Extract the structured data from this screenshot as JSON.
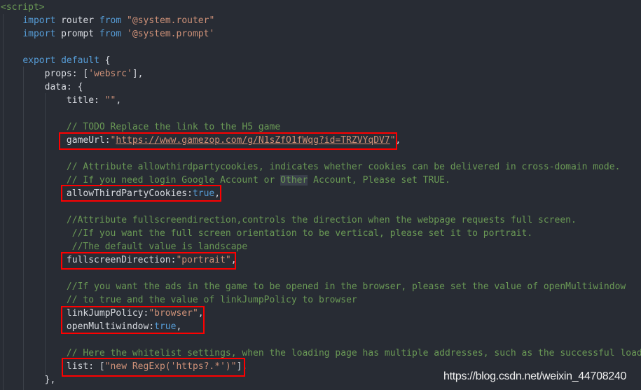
{
  "editor": {
    "colors": {
      "background": "#282c34",
      "keyword": "#569cd6",
      "string": "#ce9178",
      "comment": "#6a9955",
      "text": "#d7dae0",
      "highlight_box": "#ff0000"
    },
    "lines": [
      [
        [
          "com",
          "<script>"
        ]
      ],
      [
        [
          "",
          "    "
        ],
        [
          "kw",
          "import"
        ],
        [
          "",
          " router "
        ],
        [
          "kw",
          "from"
        ],
        [
          "",
          " "
        ],
        [
          "str",
          "\"@system.router\""
        ]
      ],
      [
        [
          "",
          "    "
        ],
        [
          "kw",
          "import"
        ],
        [
          "",
          " prompt "
        ],
        [
          "kw",
          "from"
        ],
        [
          "",
          " "
        ],
        [
          "str",
          "'@system.prompt'"
        ]
      ],
      [],
      [
        [
          "",
          "    "
        ],
        [
          "kw",
          "export"
        ],
        [
          "",
          " "
        ],
        [
          "kw",
          "default"
        ],
        [
          "",
          " {"
        ]
      ],
      [
        [
          "",
          "        props: ["
        ],
        [
          "str",
          "'websrc'"
        ],
        [
          "",
          "],"
        ]
      ],
      [
        [
          "",
          "        data: {"
        ]
      ],
      [
        [
          "",
          "            title: "
        ],
        [
          "str",
          "\"\""
        ],
        [
          "",
          ","
        ]
      ],
      [],
      [
        [
          "",
          "            "
        ],
        [
          "com",
          "// TODO Replace the link to the H5 game"
        ]
      ],
      [
        [
          "",
          "            gameUrl:"
        ],
        [
          "str",
          "\""
        ],
        [
          "url",
          "https://www.gamezop.com/g/N1sZfO1fWqg?id=TRZVYqDV7"
        ],
        [
          "str",
          "\""
        ],
        [
          "",
          ","
        ]
      ],
      [],
      [
        [
          "",
          "            "
        ],
        [
          "com",
          "// Attribute allowthirdpartycookies, indicates whether cookies can be delivered in cross-domain mode."
        ]
      ],
      [
        [
          "",
          "            "
        ],
        [
          "com",
          "// If you need login Google Account or "
        ],
        [
          "com sel",
          "Other"
        ],
        [
          "com",
          " Account, Please set TRUE."
        ]
      ],
      [
        [
          "",
          "            allowThirdPartyCookies:"
        ],
        [
          "bool",
          "true"
        ],
        [
          "",
          ","
        ]
      ],
      [],
      [
        [
          "",
          "            "
        ],
        [
          "com",
          "//Attribute fullscreendirection,controls the direction when the webpage requests full screen."
        ]
      ],
      [
        [
          "",
          "             "
        ],
        [
          "com",
          "//If you want the full screen orientation to be vertical, please set it to portrait."
        ]
      ],
      [
        [
          "",
          "             "
        ],
        [
          "com",
          "//The default value is landscape"
        ]
      ],
      [
        [
          "",
          "            fullscreenDirection:"
        ],
        [
          "str",
          "\"portrait\""
        ],
        [
          "",
          ","
        ]
      ],
      [],
      [
        [
          "",
          "            "
        ],
        [
          "com",
          "//If you want the ads in the game to be opened in the browser, please set the value of openMultiwindow"
        ]
      ],
      [
        [
          "",
          "            "
        ],
        [
          "com",
          "// to true and the value of linkJumpPolicy to browser"
        ]
      ],
      [
        [
          "",
          "            linkJumpPolicy:"
        ],
        [
          "str",
          "\"browser\""
        ],
        [
          "",
          ","
        ]
      ],
      [
        [
          "",
          "            openMultiwindow:"
        ],
        [
          "bool",
          "true"
        ],
        [
          "",
          ","
        ]
      ],
      [],
      [
        [
          "",
          "            "
        ],
        [
          "com",
          "// Here the whitelist settings, when the loading page has multiple addresses, such as the successful loading"
        ]
      ],
      [
        [
          "",
          "            list: ["
        ],
        [
          "str",
          "\"new RegExp('https?.*')\""
        ],
        [
          "",
          "],"
        ]
      ],
      [
        [
          "",
          "        },"
        ]
      ]
    ]
  },
  "watermark": "https://blog.csdn.net/weixin_44708240"
}
